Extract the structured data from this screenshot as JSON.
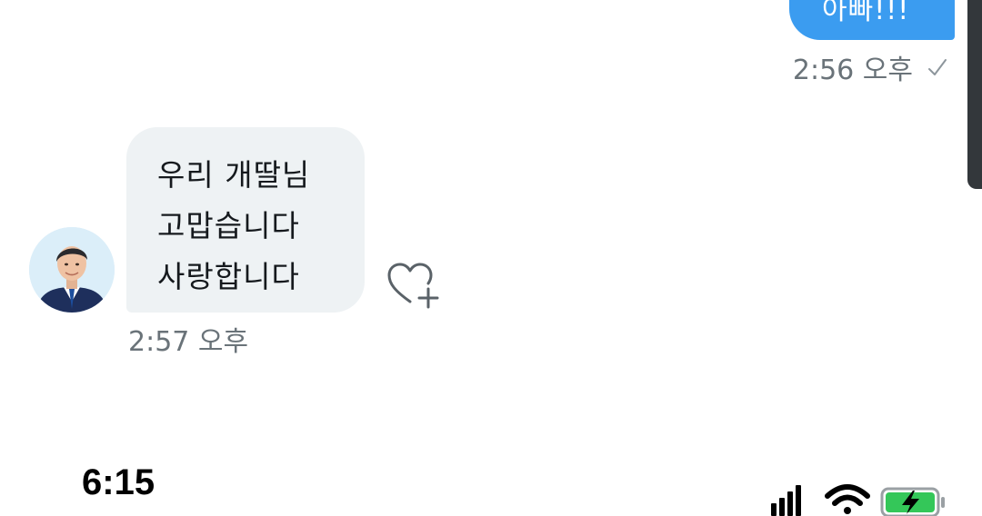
{
  "conversation": {
    "outgoing_message": {
      "text": "아빠!!!",
      "time": "2:56 오후"
    },
    "incoming_message": {
      "lines": [
        "우리 개딸님",
        "고맙습니다",
        "사랑합니다"
      ],
      "time": "2:57 오후"
    }
  },
  "status_bar": {
    "time": "6:15"
  },
  "icons": {
    "read_receipt": "check-icon",
    "react": "heart-plus-icon",
    "signal": "cellular-signal-icon",
    "wifi": "wifi-icon",
    "battery": "battery-charging-icon"
  },
  "colors": {
    "outgoing_bubble": "#3b9cf0",
    "incoming_bubble": "#eef2f4",
    "meta_text": "#6a7379",
    "battery_fill": "#34c759"
  }
}
